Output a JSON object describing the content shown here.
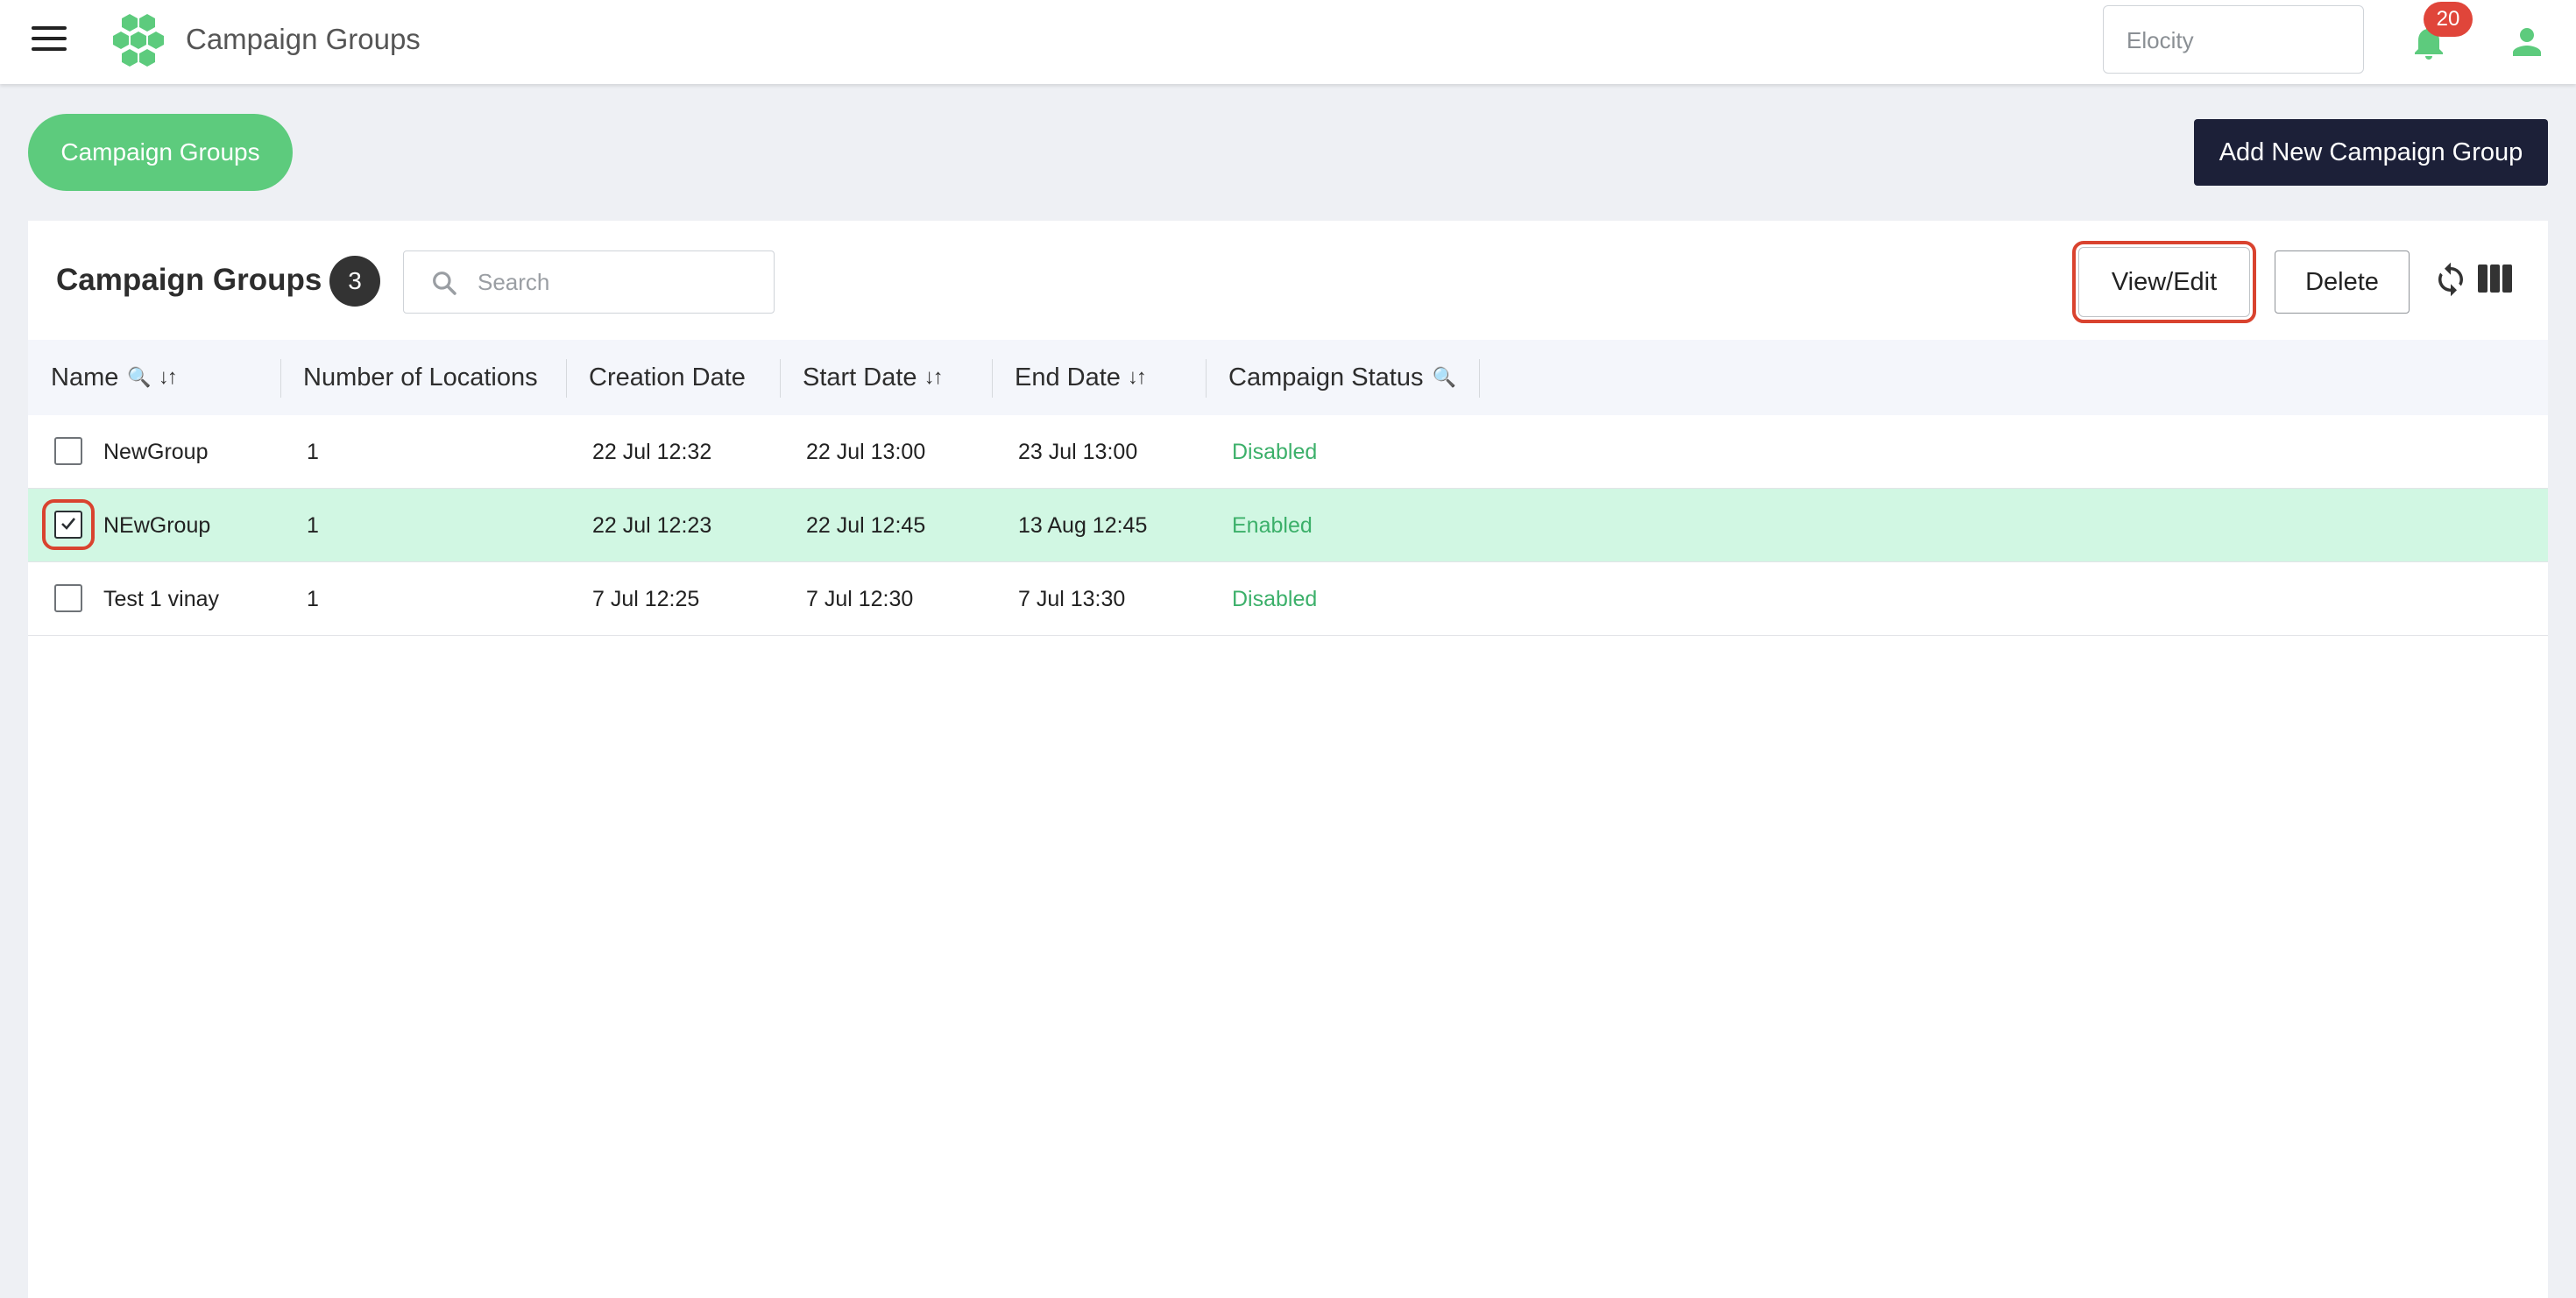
{
  "header": {
    "app_title": "Campaign Groups",
    "org_placeholder": "Elocity",
    "notification_count": "20"
  },
  "toolbar": {
    "pill_label": "Campaign Groups",
    "add_button": "Add New Campaign Group"
  },
  "card": {
    "title": "Campaign Groups",
    "count": "3",
    "search_placeholder": "Search",
    "view_edit": "View/Edit",
    "delete": "Delete"
  },
  "table": {
    "columns": [
      "Name",
      "Number of Locations",
      "Creation Date",
      "Start Date",
      "End Date",
      "Campaign Status"
    ],
    "rows": [
      {
        "name": "NewGroup",
        "locations": "1",
        "created": "22 Jul 12:32",
        "start": "22 Jul 13:00",
        "end": "23 Jul 13:00",
        "status": "Disabled",
        "checked": false
      },
      {
        "name": "NEwGroup",
        "locations": "1",
        "created": "22 Jul 12:23",
        "start": "22 Jul 12:45",
        "end": "13 Aug 12:45",
        "status": "Enabled",
        "checked": true
      },
      {
        "name": "Test 1 vinay",
        "locations": "1",
        "created": "7 Jul 12:25",
        "start": "7 Jul 12:30",
        "end": "7 Jul 13:30",
        "status": "Disabled",
        "checked": false
      }
    ]
  },
  "colors": {
    "brand_green": "#5dcb7d",
    "dark_button": "#1c2038",
    "selected_row": "#d1f7e3",
    "status_green": "#3cb06a",
    "highlight_red": "#d9432f"
  },
  "icons": [
    "menu-icon",
    "logo-icon",
    "bell-icon",
    "user-icon",
    "search-icon",
    "refresh-icon",
    "columns-icon",
    "filter-search-icon",
    "sort-icon",
    "check-icon"
  ]
}
